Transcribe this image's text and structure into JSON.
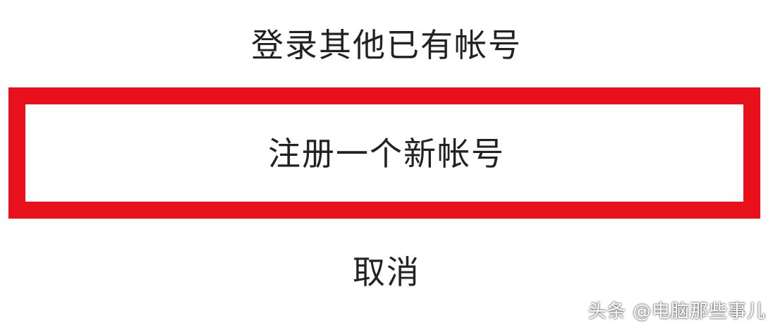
{
  "sheet": {
    "options": {
      "login_other": "登录其他已有帐号",
      "register_new": "注册一个新帐号",
      "cancel": "取消"
    },
    "highlight_color": "#e8101b"
  },
  "watermark": {
    "text": "头条 @电脑那些事儿"
  }
}
